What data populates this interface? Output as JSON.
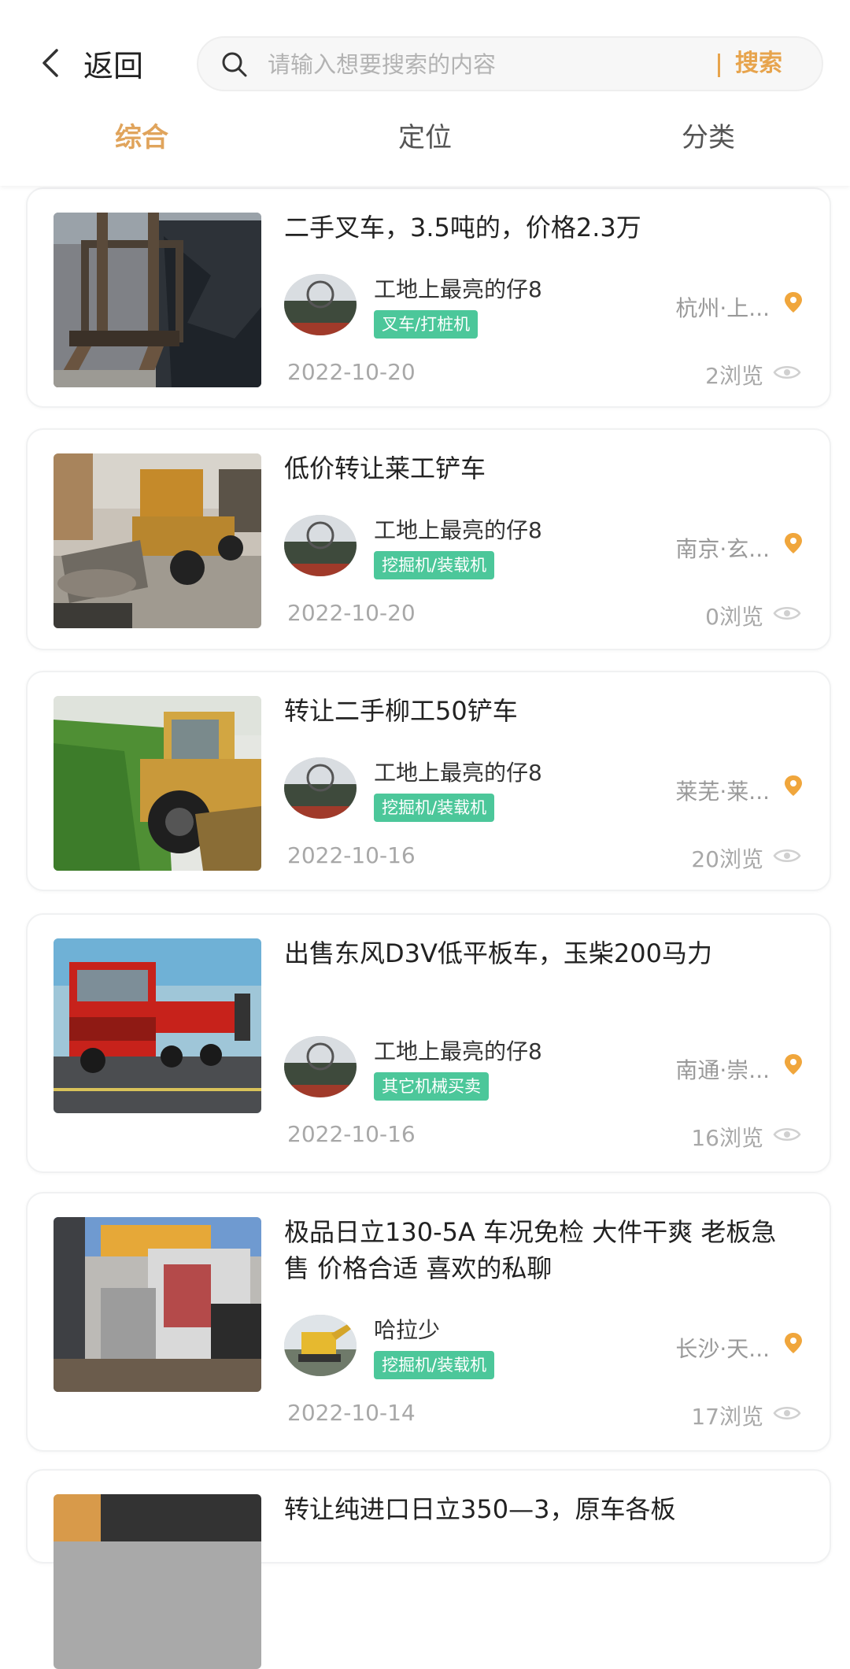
{
  "header": {
    "back_label": "返回",
    "search_placeholder": "请输入想要搜索的内容",
    "search_button": "搜索"
  },
  "tabs": [
    {
      "label": "综合",
      "active": true
    },
    {
      "label": "定位",
      "active": false
    },
    {
      "label": "分类",
      "active": false
    }
  ],
  "colors": {
    "accent": "#e0a45c",
    "tag_green": "#4cc79a",
    "pin_orange": "#f0a63c"
  },
  "listings": [
    {
      "title": "二手叉车，3.5吨的，价格2.3万",
      "seller": "工地上最亮的仔8",
      "category": "叉车/打桩机",
      "location": "杭州·上...",
      "date": "2022-10-20",
      "views": "2浏览"
    },
    {
      "title": "低价转让莱工铲车",
      "seller": "工地上最亮的仔8",
      "category": "挖掘机/装载机",
      "location": "南京·玄...",
      "date": "2022-10-20",
      "views": "0浏览"
    },
    {
      "title": "转让二手柳工50铲车",
      "seller": "工地上最亮的仔8",
      "category": "挖掘机/装载机",
      "location": "莱芜·莱...",
      "date": "2022-10-16",
      "views": "20浏览"
    },
    {
      "title": "出售东风D3V低平板车，玉柴200马力",
      "seller": "工地上最亮的仔8",
      "category": "其它机械买卖",
      "location": "南通·崇...",
      "date": "2022-10-16",
      "views": "16浏览"
    },
    {
      "title": "极品日立130-5A 车况免检 大件干爽 老板急售 价格合适 喜欢的私聊",
      "seller": "哈拉少",
      "category": "挖掘机/装载机",
      "location": "长沙·天...",
      "date": "2022-10-14",
      "views": "17浏览"
    },
    {
      "title": "转让纯进口日立350—3，原车各板"
    }
  ]
}
